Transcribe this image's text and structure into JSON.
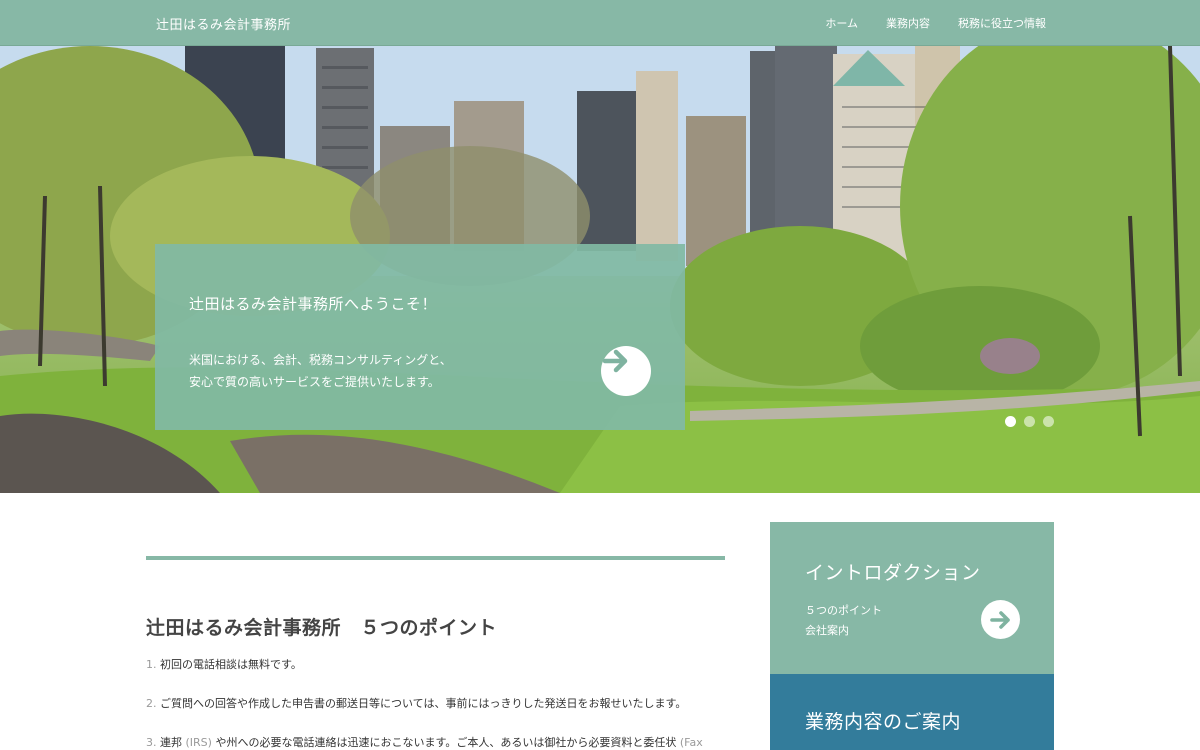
{
  "site": {
    "title": "辻田はるみ会計事務所",
    "nav": [
      {
        "label": "ホーム"
      },
      {
        "label": "業務内容"
      },
      {
        "label": "税務に役立つ情報"
      }
    ]
  },
  "hero": {
    "title": "辻田はるみ会計事務所へようこそ！",
    "line1": "米国における、会計、税務コンサルティングと、",
    "line2": "安心で質の高いサービスをご提供いたします。",
    "arrow_icon": "arrow-right-icon",
    "slides_total": 3,
    "slide_active": 1
  },
  "main": {
    "section_title": "辻田はるみ会計事務所　５つのポイント",
    "points": [
      {
        "num": "1.",
        "text": "初回の電話相談は無料です。"
      },
      {
        "num": "2.",
        "text": "ご質問への回答や作成した申告書の郵送日等については、事前にはっきりした発送日をお報せいたします。"
      },
      {
        "num": "3.",
        "pre": "連邦 ",
        "muted1": "(IRS)",
        "mid": " や州への必要な電話連絡は迅速におこないます。ご本人、あるいは御社から必要資料と委任状 ",
        "muted2": "(Fax"
      }
    ]
  },
  "sidebar": {
    "intro_title": "イントロダクション",
    "intro_links": [
      {
        "label": "５つのポイント"
      },
      {
        "label": "会社案内"
      }
    ],
    "services_title": "業務内容のご案内"
  },
  "colors": {
    "accent": "#87b8a6",
    "services": "#337c9b",
    "text": "#444444"
  }
}
